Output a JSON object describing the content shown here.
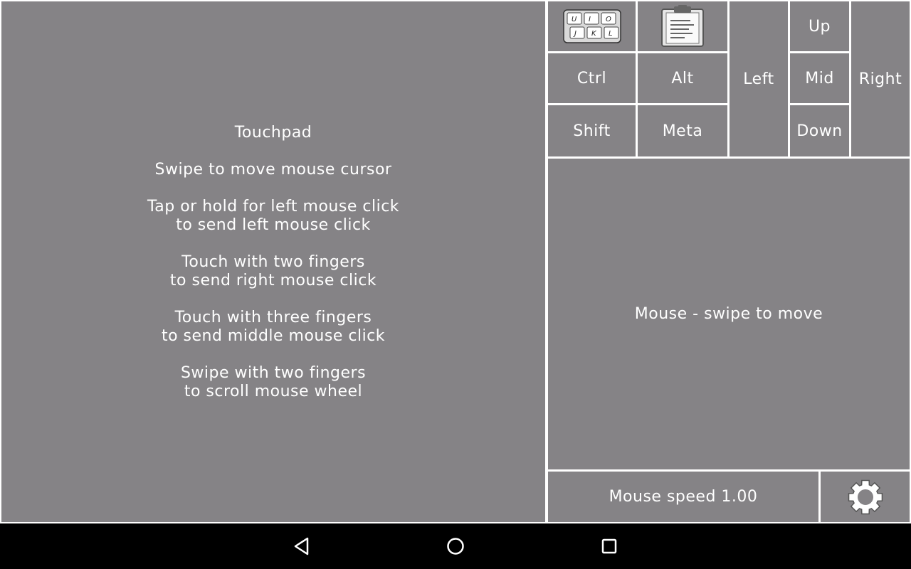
{
  "touchpad": {
    "title": "Touchpad",
    "instructions": [
      "Swipe to move mouse cursor",
      "Tap or hold for left mouse click\nto send left mouse click",
      "Touch with two fingers\nto send right mouse click",
      "Touch with three fingers\nto send middle mouse click",
      "Swipe with two fingers\nto scroll mouse wheel"
    ]
  },
  "buttons": {
    "keyboard_icon": "keyboard-icon",
    "clipboard_icon": "clipboard-icon",
    "keyboard_keys": [
      "U",
      "I",
      "O",
      "J",
      "K",
      "L"
    ],
    "ctrl": "Ctrl",
    "alt": "Alt",
    "shift": "Shift",
    "meta": "Meta",
    "left": "Left",
    "up": "Up",
    "mid": "Mid",
    "down": "Down",
    "right": "Right"
  },
  "mouse_area": {
    "label": "Mouse - swipe to move"
  },
  "mouse_speed": {
    "label": "Mouse speed 1.00"
  },
  "settings_icon": "gear-icon",
  "navigation": {
    "back_icon": "back-triangle-icon",
    "home_icon": "home-circle-icon",
    "recents_icon": "recents-square-icon"
  },
  "colors": {
    "panel": "#858386",
    "divider": "#ffffff",
    "nav_bar": "#000000"
  }
}
